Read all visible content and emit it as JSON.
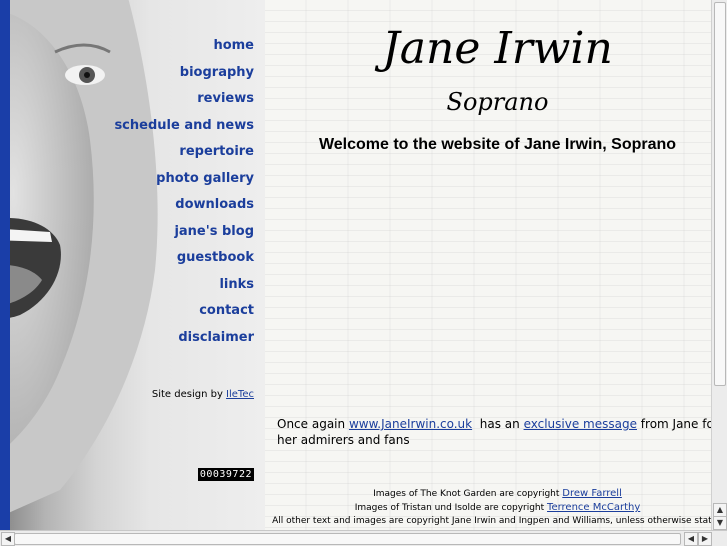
{
  "nav": {
    "items": [
      {
        "label": "home"
      },
      {
        "label": "biography"
      },
      {
        "label": "reviews"
      },
      {
        "label": "schedule and news"
      },
      {
        "label": "repertoire"
      },
      {
        "label": "photo gallery"
      },
      {
        "label": "downloads"
      },
      {
        "label": "jane's blog"
      },
      {
        "label": "guestbook"
      },
      {
        "label": "links"
      },
      {
        "label": "contact"
      },
      {
        "label": "disclaimer"
      }
    ]
  },
  "sidebar": {
    "site_design_prefix": "Site design by ",
    "site_design_link": "IleTec",
    "counter": "00039722"
  },
  "header": {
    "title": "Jane Irwin",
    "subtitle": "Soprano",
    "welcome": "Welcome to the website of Jane Irwin, Soprano"
  },
  "message": {
    "prefix": "Once again ",
    "site_link": "www.JaneIrwin.co.uk",
    "middle": "  has an ",
    "message_link": "exclusive message",
    "suffix": " from Jane for a",
    "line2": "her admirers and fans"
  },
  "credits": {
    "line1_prefix": "Images of The Knot Garden are copyright ",
    "line1_link": "Drew Farrell ",
    "line2_prefix": "Images of Tristan und Isolde are copyright ",
    "line2_link": "Terrence McCarthy",
    "line3": "All other text and images are copyright Jane Irwin and Ingpen and Williams, unless otherwise stated"
  },
  "scrollbar_icons": {
    "up": "arrow-up-icon",
    "down": "arrow-down-icon",
    "left": "arrow-left-icon",
    "right": "arrow-right-icon"
  },
  "colors": {
    "link": "#1b3e9c",
    "left_strip": "#1a3ea8"
  }
}
